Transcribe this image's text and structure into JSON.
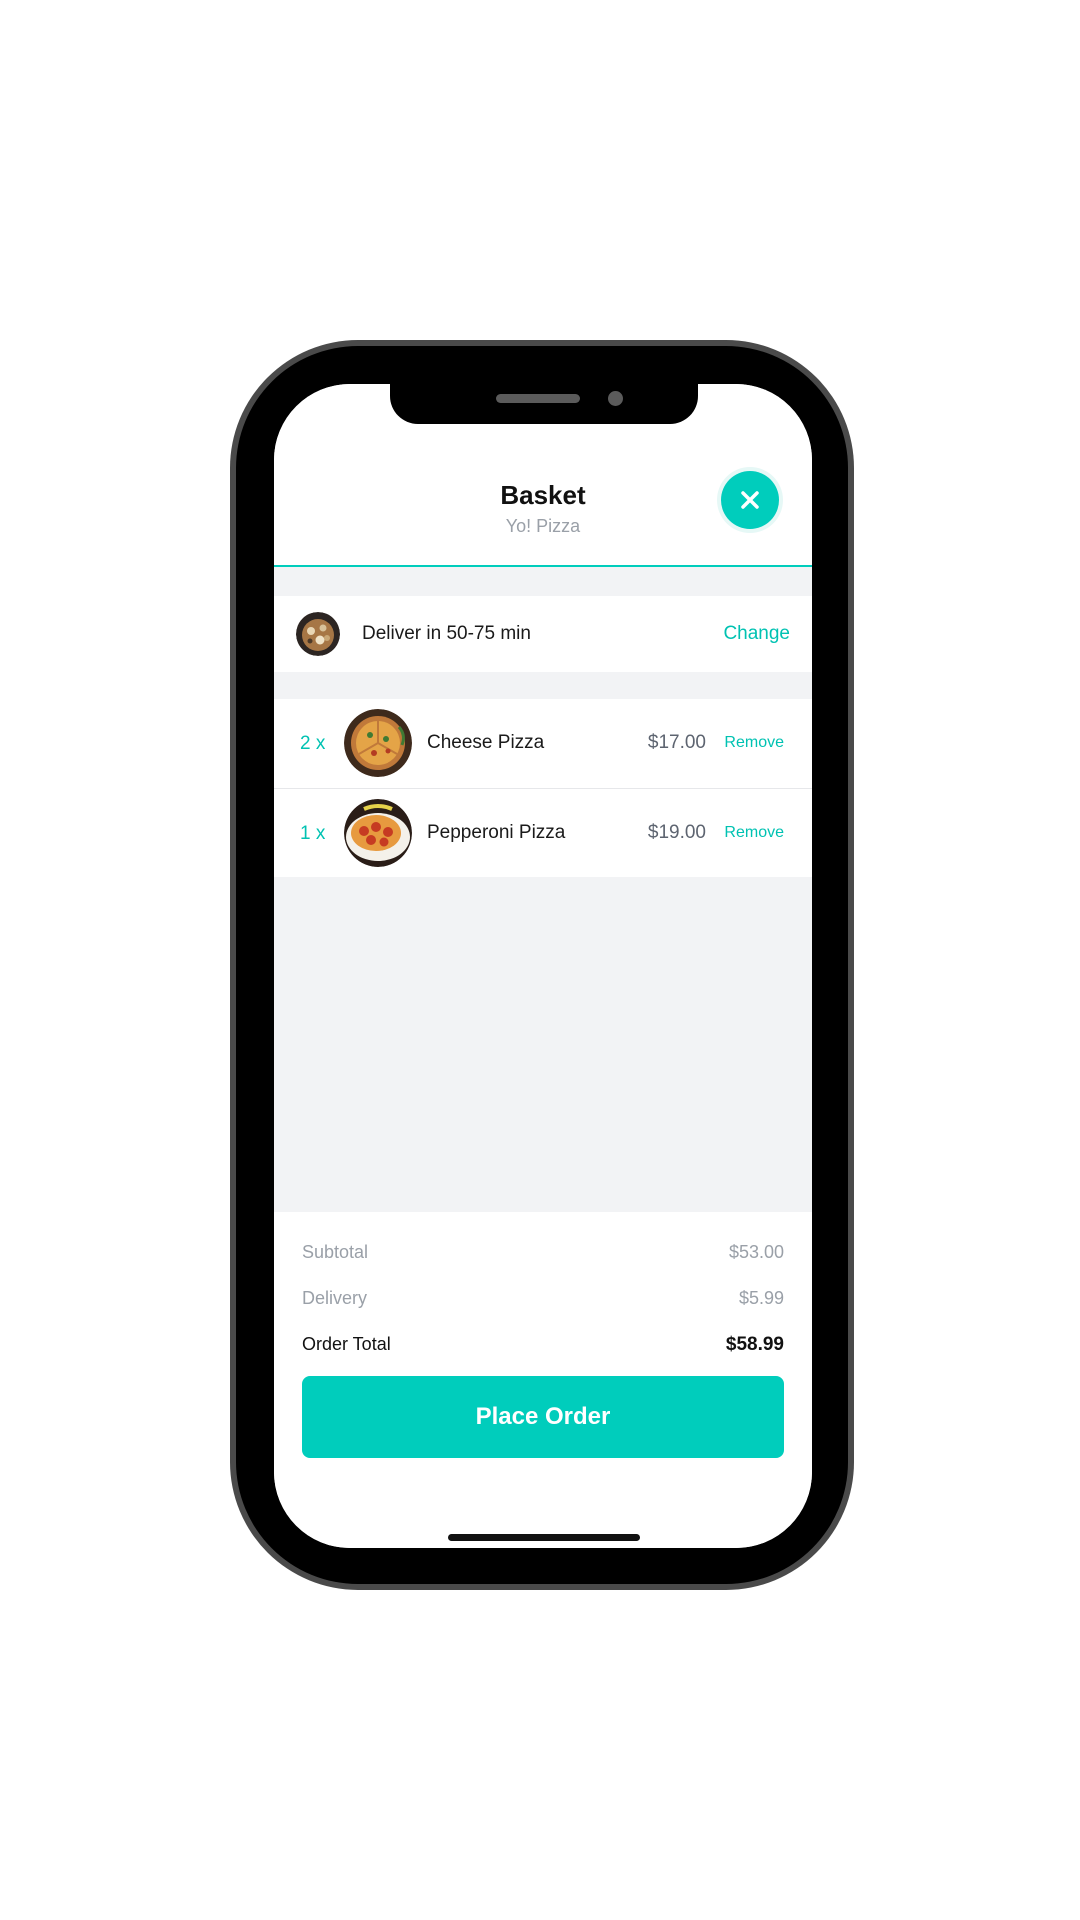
{
  "header": {
    "title": "Basket",
    "subtitle": "Yo! Pizza",
    "close_icon": "close-icon"
  },
  "delivery": {
    "text": "Deliver in 50-75 min",
    "change_label": "Change"
  },
  "items": [
    {
      "qty": "2 x",
      "name": "Cheese Pizza",
      "price": "$17.00",
      "remove_label": "Remove"
    },
    {
      "qty": "1 x",
      "name": "Pepperoni Pizza",
      "price": "$19.00",
      "remove_label": "Remove"
    }
  ],
  "summary": {
    "subtotal_label": "Subtotal",
    "subtotal_value": "$53.00",
    "delivery_label": "Delivery",
    "delivery_value": "$5.99",
    "total_label": "Order Total",
    "total_value": "$58.99"
  },
  "actions": {
    "place_order_label": "Place Order"
  },
  "colors": {
    "accent": "#00cdbc",
    "link": "#00c2b2",
    "muted": "#9aa0a8",
    "page_bg": "#f2f3f5"
  }
}
